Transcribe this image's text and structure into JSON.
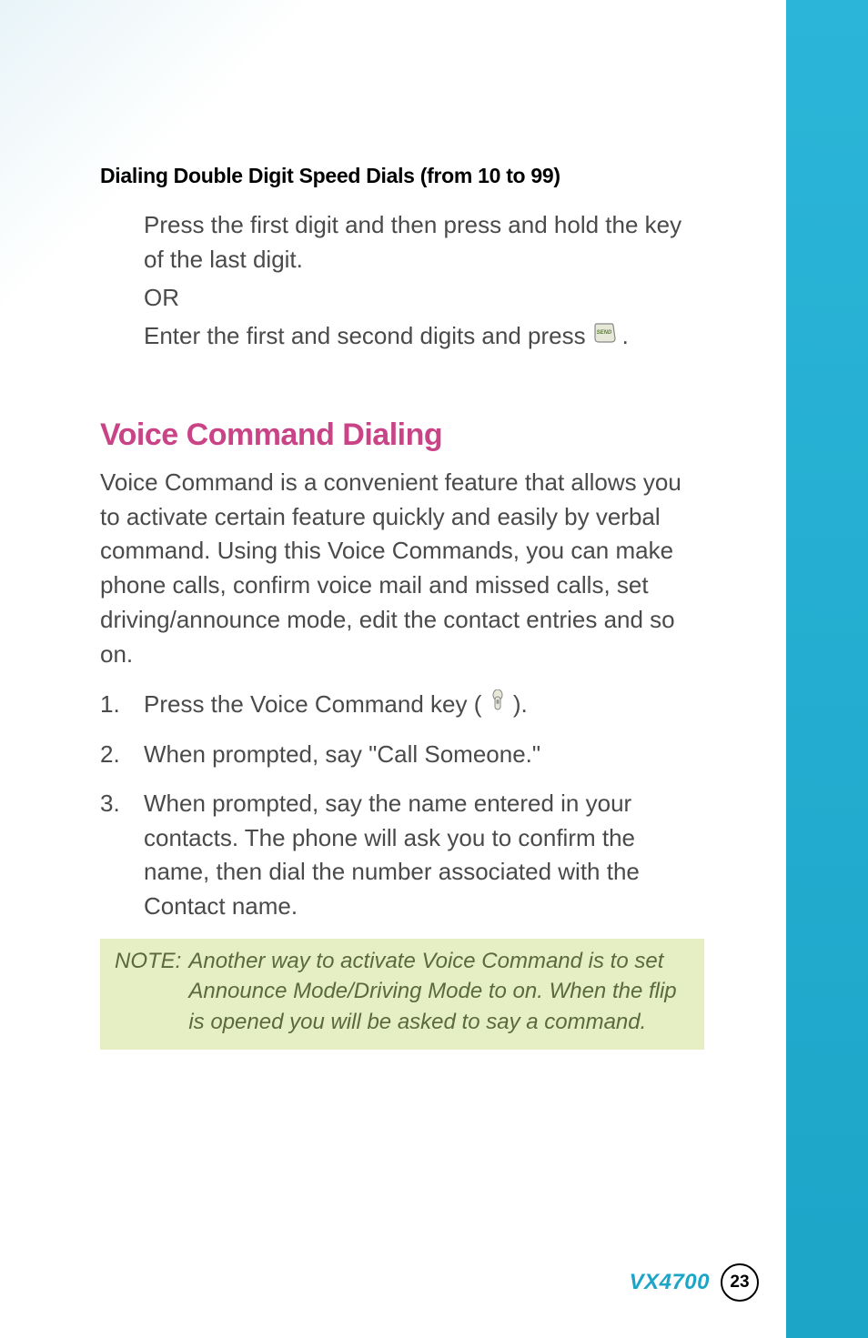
{
  "section1": {
    "heading": "Dialing Double Digit Speed Dials (from 10 to 99)",
    "para1": "Press the first digit and then press and hold the key of the last digit.",
    "or": "OR",
    "para2_before": "Enter the first and second digits and press",
    "para2_after": "."
  },
  "section2": {
    "heading": "Voice Command Dialing",
    "intro": "Voice Command is a convenient feature that allows you to activate certain feature quickly and easily by verbal command. Using this Voice Commands, you can make phone calls, confirm voice mail and missed calls, set driving/announce mode, edit the contact entries and so on.",
    "step1_before": "Press the Voice Command key (",
    "step1_after": ").",
    "step2": "When prompted, say \"Call Someone.\"",
    "step3": "When prompted, say the name entered in your contacts. The phone will ask you to confirm the name, then dial the number associated with the Contact name."
  },
  "note": {
    "label": "NOTE:",
    "text": "Another way to activate Voice Command is to set Announce Mode/Driving Mode to on. When the flip is opened you will be asked to say a command."
  },
  "footer": {
    "model": "VX4700",
    "page": "23"
  }
}
